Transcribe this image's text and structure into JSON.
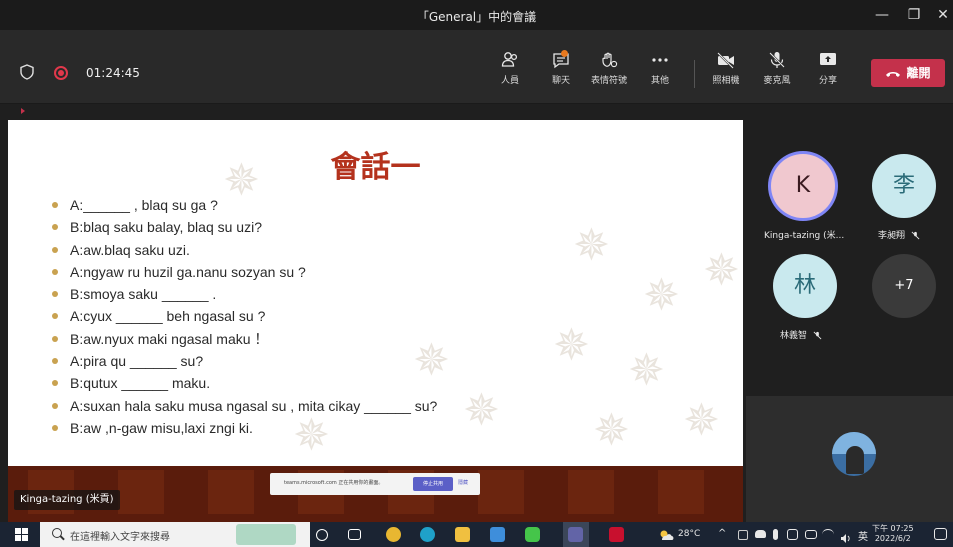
{
  "window": {
    "title": "「General」中的會議",
    "minimize": "—",
    "maximize": "❐",
    "close": "✕"
  },
  "toolbar": {
    "timer": "01:24:45",
    "buttons": [
      {
        "name": "people",
        "label": "人員"
      },
      {
        "name": "chat",
        "label": "聊天"
      },
      {
        "name": "reactions",
        "label": "表情符號"
      },
      {
        "name": "more",
        "label": "其他"
      },
      {
        "name": "camera",
        "label": "照相機"
      },
      {
        "name": "mic",
        "label": "麥克風"
      },
      {
        "name": "share",
        "label": "分享"
      }
    ],
    "leave_label": "離開"
  },
  "slide": {
    "title": "會話一",
    "lines": [
      "A:______ , blaq su ga ?",
      "B:blaq saku balay, blaq su uzi?",
      "A:aw.blaq saku uzi.",
      "A:ngyaw ru huzil ga.nanu sozyan su ?",
      "B:smoya saku ______ .",
      "A:cyux ______ beh ngasal su ?",
      "B:aw.nyux maki ngasal maku ！",
      "A:pira qu ______ su?",
      "B:qutux ______ maku.",
      "A:suxan hala saku musa ngasal su , mita cikay ______ su?",
      "B:aw ,n-gaw misu,laxi zngi ki."
    ]
  },
  "share_bar": {
    "message": "teams.microsoft.com 正在共用你的畫面。",
    "stop_label": "停止共用",
    "hide_label": "隱藏"
  },
  "presenter_tag": "Kinga-tazing (米貢)",
  "participants": [
    {
      "initial": "K",
      "name": "Kinga-tazing (米...",
      "bg": "#f0c8cf",
      "fg": "#3a1a20",
      "ring": "#7f85f5"
    },
    {
      "initial": "李",
      "name": "李昶翔",
      "bg": "#c9e9ee",
      "fg": "#2a6b78"
    },
    {
      "initial": "林",
      "name": "林義智",
      "bg": "#c9e9ee",
      "fg": "#2a6b78"
    },
    {
      "initial": "+7",
      "name": "",
      "bg": "#3a3a3a",
      "fg": "#ffffff"
    }
  ],
  "taskbar": {
    "search_placeholder": "在這裡輸入文字來搜尋",
    "weather": "28°C",
    "ime": "英",
    "time": "下午 07:25",
    "date": "2022/6/2"
  },
  "colors": {
    "leave_red": "#c4314b",
    "accent_purple": "#5b5fc7",
    "slide_title": "#b4321d",
    "bullet_gold": "#c9a250"
  }
}
